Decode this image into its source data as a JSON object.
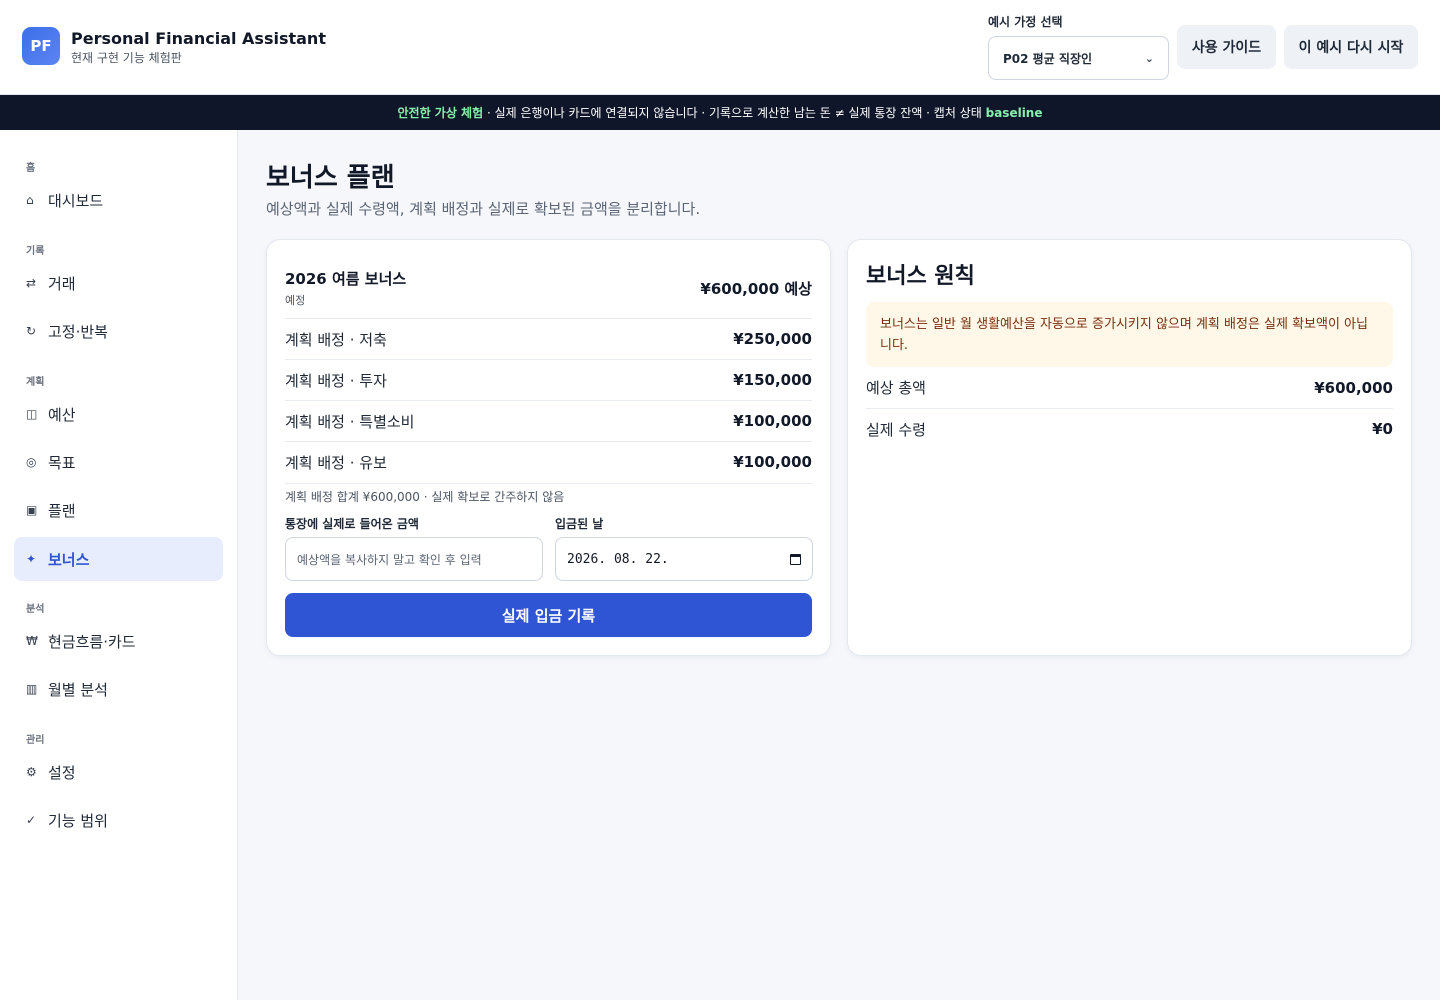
{
  "header": {
    "logo_text": "PF",
    "app_title": "Personal Financial Assistant",
    "app_subtitle": "현재 구현 기능 체험판",
    "persona_label": "예시 가정 선택",
    "persona_selected": "P02 평균 직장인",
    "guide_button": "사용 가이드",
    "restart_button": "이 예시 다시 시작"
  },
  "banner": {
    "highlight": "안전한 가상 체험",
    "text": " · 실제 은행이나 카드에 연결되지 않습니다 · 기록으로 계산한 남는 돈 ≠ 실제 통장 잔액 · 캡처 상태 ",
    "state": "baseline"
  },
  "sidebar": {
    "sections": {
      "home": "홈",
      "record": "기록",
      "plan": "계획",
      "analysis": "분석",
      "manage": "관리"
    },
    "items": {
      "dashboard": {
        "icon": "⌂",
        "label": "대시보드"
      },
      "transactions": {
        "icon": "⇄",
        "label": "거래"
      },
      "recurring": {
        "icon": "↻",
        "label": "고정·반복"
      },
      "budget": {
        "icon": "◫",
        "label": "예산"
      },
      "goals": {
        "icon": "◎",
        "label": "목표"
      },
      "plans": {
        "icon": "▣",
        "label": "플랜"
      },
      "bonus": {
        "icon": "✦",
        "label": "보너스"
      },
      "cashflow": {
        "icon": "₩",
        "label": "현금흐름·카드"
      },
      "monthly": {
        "icon": "▥",
        "label": "월별 분석"
      },
      "settings": {
        "icon": "⚙",
        "label": "설정"
      },
      "scope": {
        "icon": "✓",
        "label": "기능 범위"
      }
    },
    "active": "bonus"
  },
  "main": {
    "title": "보너스 플랜",
    "subtitle": "예상액과 실제 수령액, 계획 배정과 실제로 확보된 금액을 분리합니다."
  },
  "bonus_card": {
    "name": "2026 여름 보너스",
    "status": "예정",
    "expected": "¥600,000 예상",
    "allocations": [
      {
        "label": "계획 배정 · 저축",
        "amount": "¥250,000"
      },
      {
        "label": "계획 배정 · 투자",
        "amount": "¥150,000"
      },
      {
        "label": "계획 배정 · 특별소비",
        "amount": "¥100,000"
      },
      {
        "label": "계획 배정 · 유보",
        "amount": "¥100,000"
      }
    ],
    "total_note": "계획 배정 합계 ¥600,000 · 실제 확보로 간주하지 않음",
    "amount_label": "통장에 실제로 들어온 금액",
    "amount_placeholder": "예상액을 복사하지 말고 확인 후 입력",
    "date_label": "입금된 날",
    "date_value": "2026. 08. 22.",
    "submit_label": "실제 입금 기록"
  },
  "rules_card": {
    "title": "보너스 원칙",
    "note": "보너스는 일반 월 생활예산을 자동으로 증가시키지 않으며 계획 배정은 실제 확보액이 아닙니다.",
    "rows": [
      {
        "label": "예상 총액",
        "amount": "¥600,000"
      },
      {
        "label": "실제 수령",
        "amount": "¥0"
      }
    ]
  }
}
